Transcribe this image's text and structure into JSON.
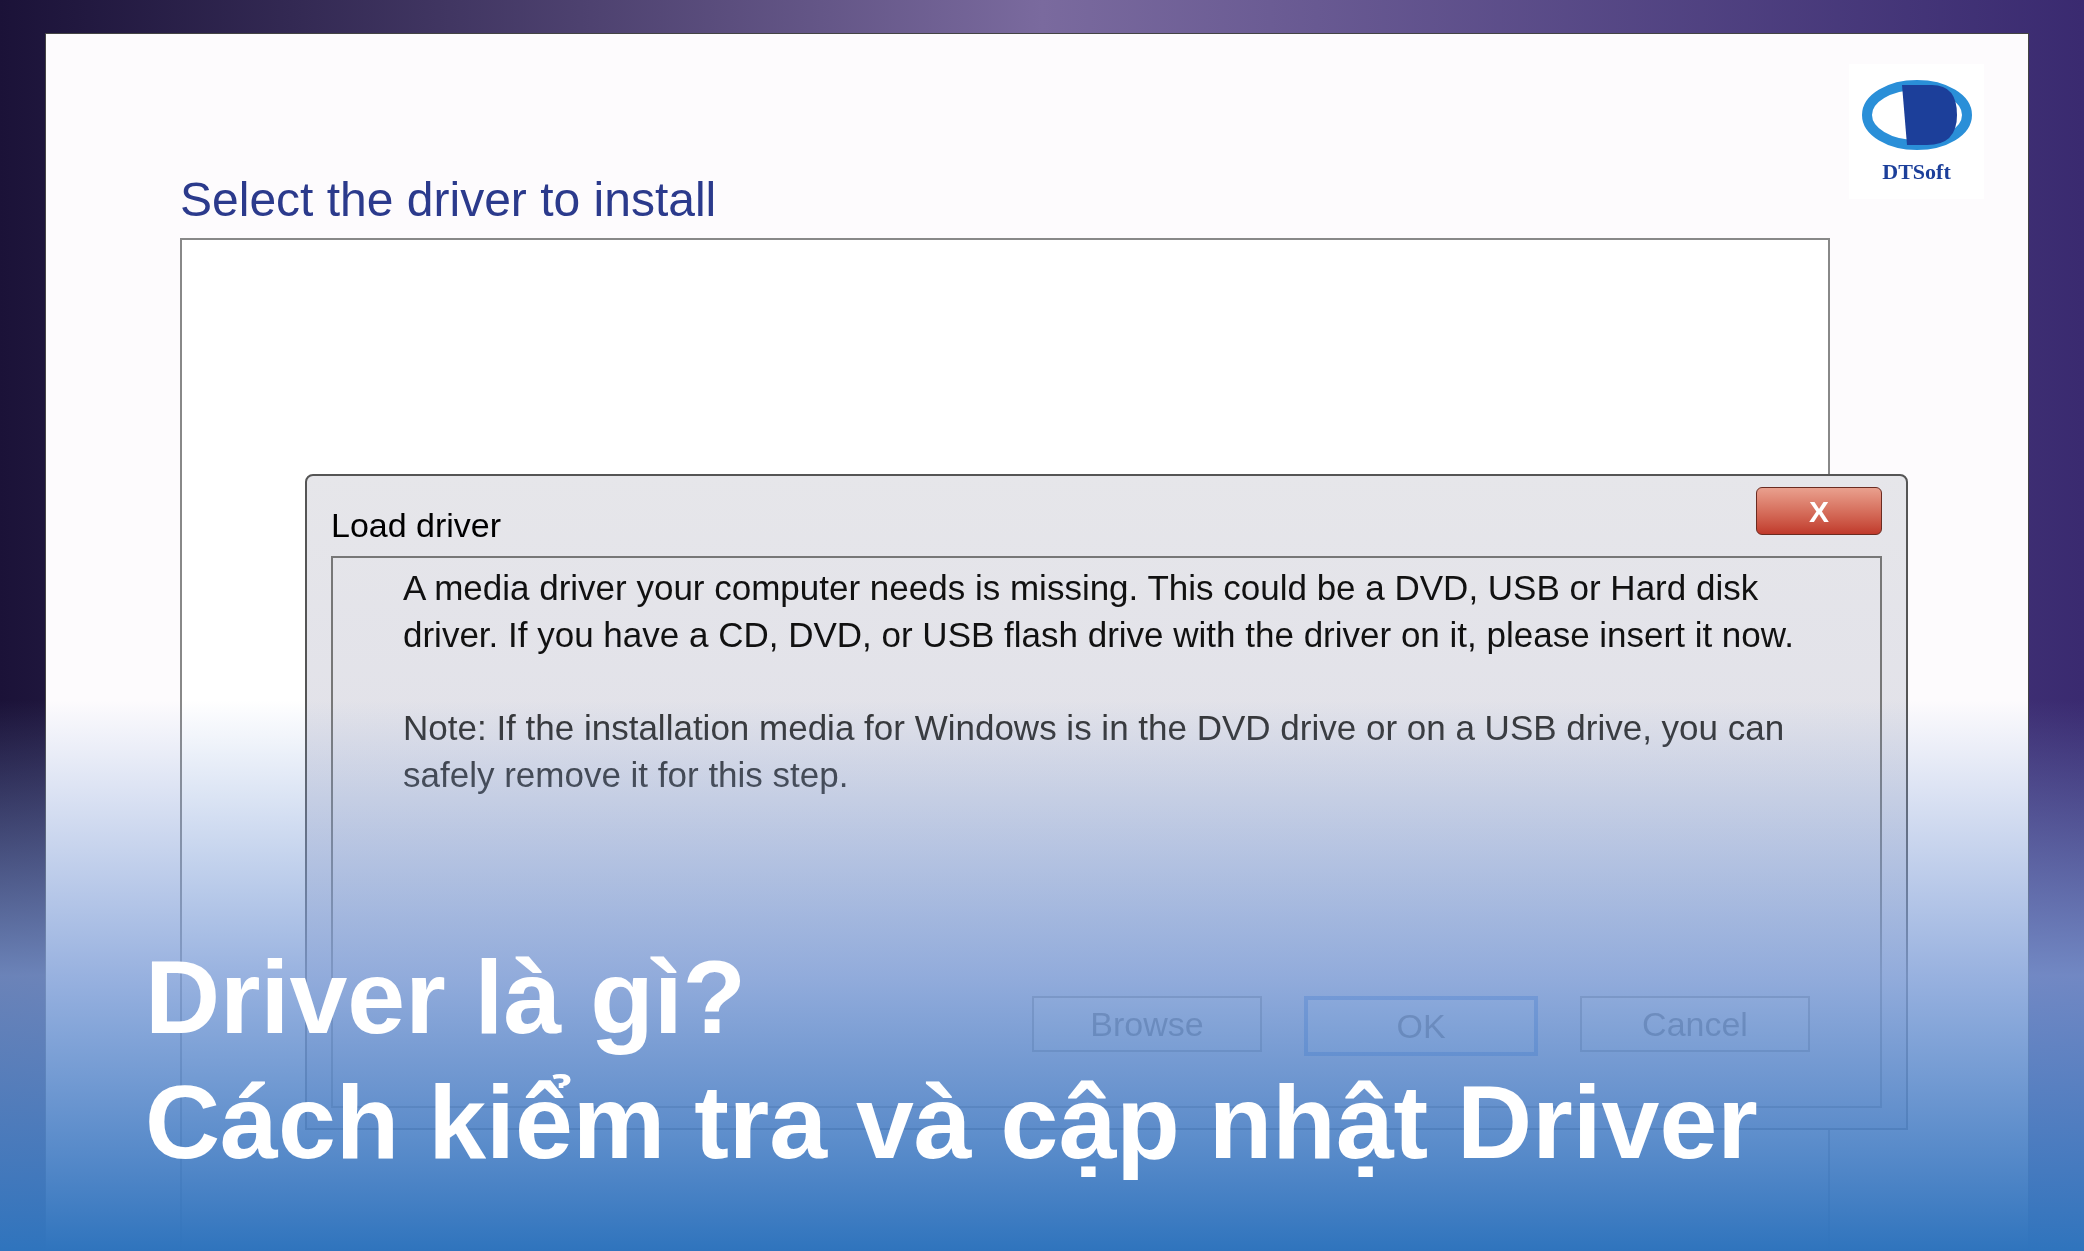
{
  "window": {
    "title": "Select the driver to install"
  },
  "logo": {
    "text": "DTSoft"
  },
  "dialog": {
    "title": "Load driver",
    "close": "X",
    "message": "A media driver your computer needs is missing. This could be a DVD, USB or Hard disk driver. If you have a CD, DVD, or USB flash drive with the driver on it, please insert it now.",
    "note": "Note: If the installation media for Windows is in the DVD drive or on a USB drive, you can safely remove it for this step.",
    "buttons": [
      {
        "label": "Browse",
        "default": false
      },
      {
        "label": "OK",
        "default": true
      },
      {
        "label": "Cancel",
        "default": false
      }
    ]
  },
  "headline": [
    "Driver là gì?",
    "Cách kiểm tra và cập nhật Driver"
  ]
}
